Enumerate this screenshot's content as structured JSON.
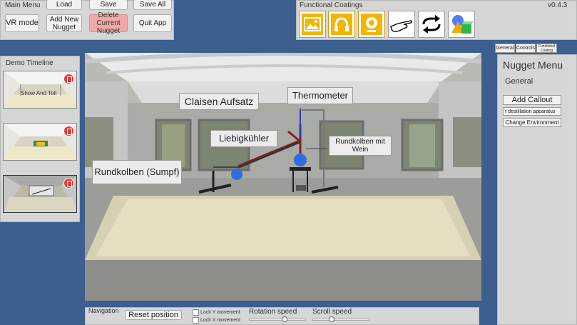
{
  "main_menu": {
    "title": "Main Menu",
    "buttons": {
      "load": "Load",
      "save": "Save",
      "save_all": "Save All",
      "vr_mode": "VR mode",
      "add_nugget": "Add New Nugget",
      "delete_nugget": "Delete Current Nugget",
      "quit": "Quit App"
    }
  },
  "functional_coatings": {
    "title": "Functional Coatings",
    "version": "v0.4.3",
    "icons": [
      "image-icon",
      "headphones-icon",
      "webcam-icon",
      "pointing-hand-icon",
      "rotate-arrows-icon",
      "3d-shapes-icon"
    ]
  },
  "timeline": {
    "title": "Demo Timeline",
    "thumb_text": "Show And Tell"
  },
  "scene": {
    "labels": {
      "claisen": "Claisen Aufsatz",
      "thermometer": "Thermometer",
      "liebig": "Liebigkühler",
      "rundkolben_wein": "Rundkolben mit Wein",
      "rundkolben_sumpf": "Rundkolben (Sumpf)"
    }
  },
  "tabs": {
    "general": "General",
    "controls": "Controls",
    "functional": "Functional Coating"
  },
  "nugget_menu": {
    "title": "Nugget Menu",
    "section": "General",
    "add_callout": "Add Callout",
    "name_value": "r destillation apparatus",
    "change_env": "Change Environment"
  },
  "navigation": {
    "title": "Navigation",
    "reset": "Reset position",
    "lock_y": "Lock Y movement",
    "lock_x": "Lock X movement",
    "rotation_label": "Rotation speed",
    "scroll_label": "Scroll speed",
    "rotation_value": 0.6,
    "scroll_value": 0.3
  }
}
